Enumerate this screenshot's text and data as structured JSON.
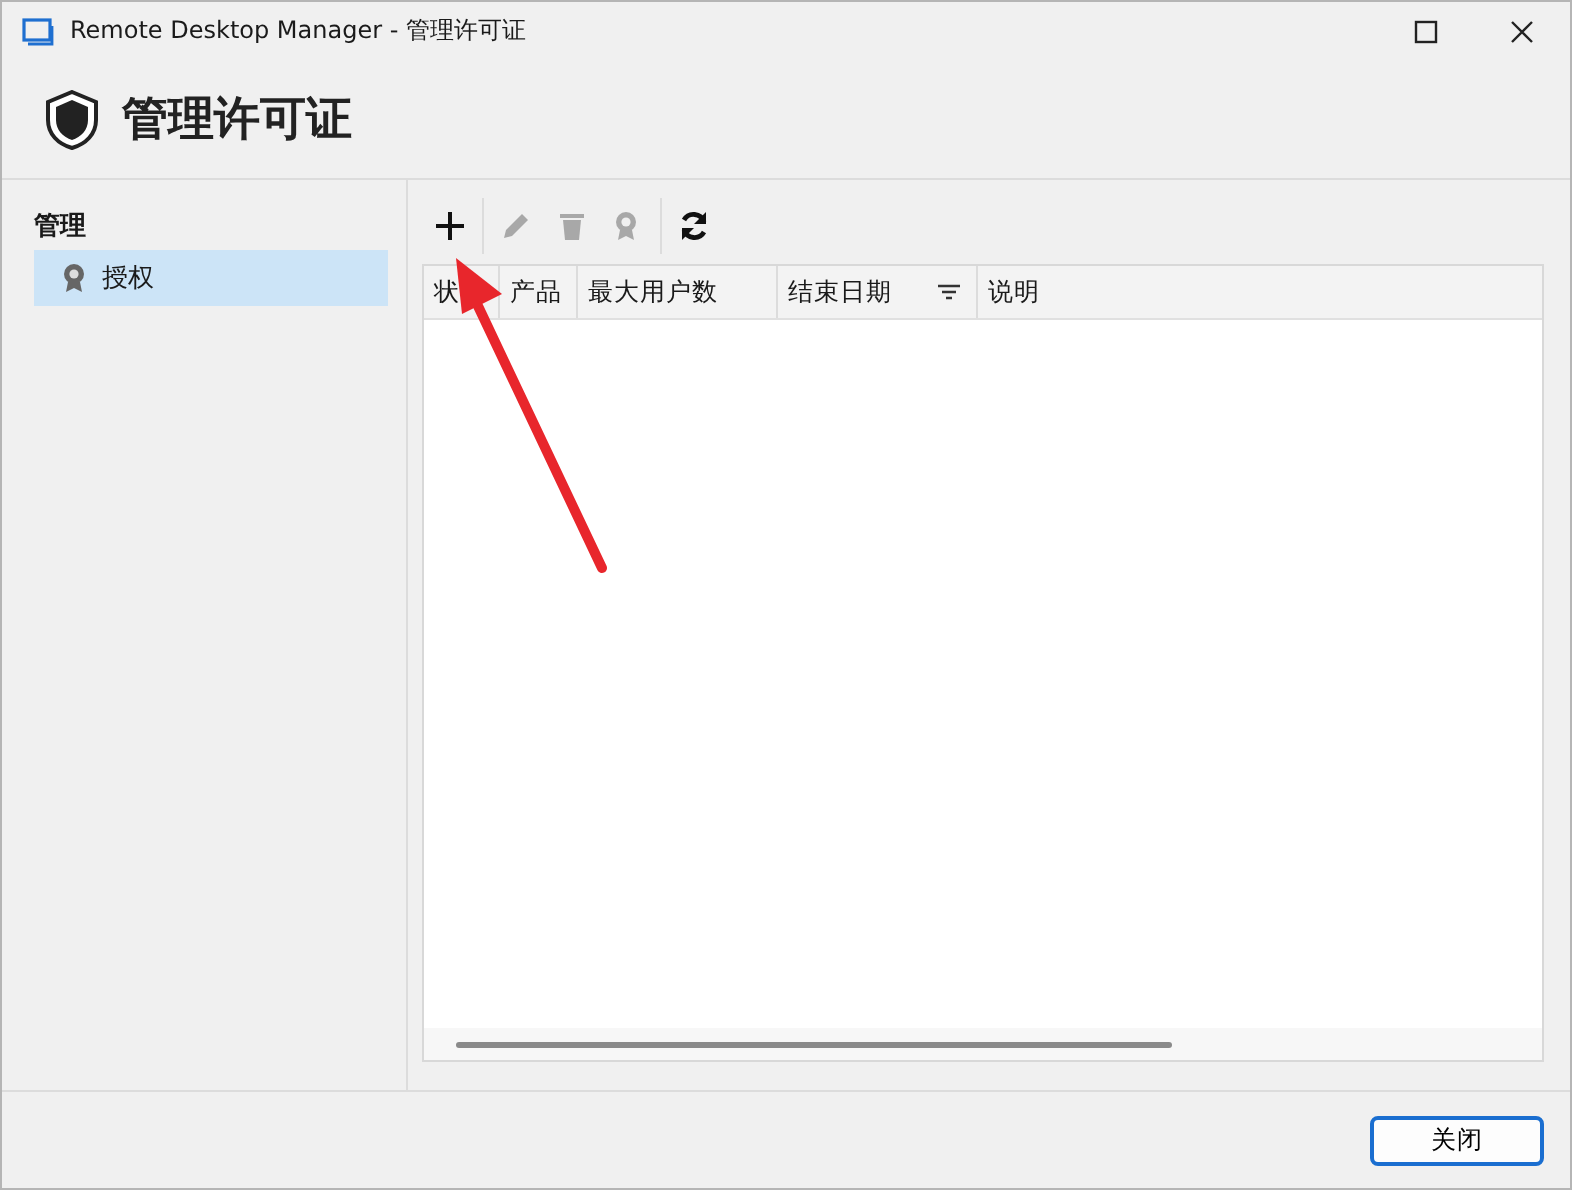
{
  "window": {
    "title": "Remote Desktop Manager - 管理许可证"
  },
  "header": {
    "title": "管理许可证"
  },
  "sidebar": {
    "section": "管理",
    "items": [
      {
        "label": "授权",
        "selected": true
      }
    ]
  },
  "toolbar": [
    {
      "kind": "add",
      "disabled": false
    },
    {
      "kind": "edit",
      "disabled": true
    },
    {
      "kind": "delete",
      "disabled": true
    },
    {
      "kind": "license",
      "disabled": true
    },
    {
      "kind": "refresh",
      "disabled": false
    }
  ],
  "table": {
    "columns": [
      {
        "label": "状",
        "filter": false
      },
      {
        "label": "产品",
        "filter": false
      },
      {
        "label": "最大用户数",
        "filter": false
      },
      {
        "label": "结束日期",
        "filter": true
      },
      {
        "label": "说明",
        "filter": false
      }
    ]
  },
  "buttons": [
    {
      "label": "关闭"
    }
  ]
}
